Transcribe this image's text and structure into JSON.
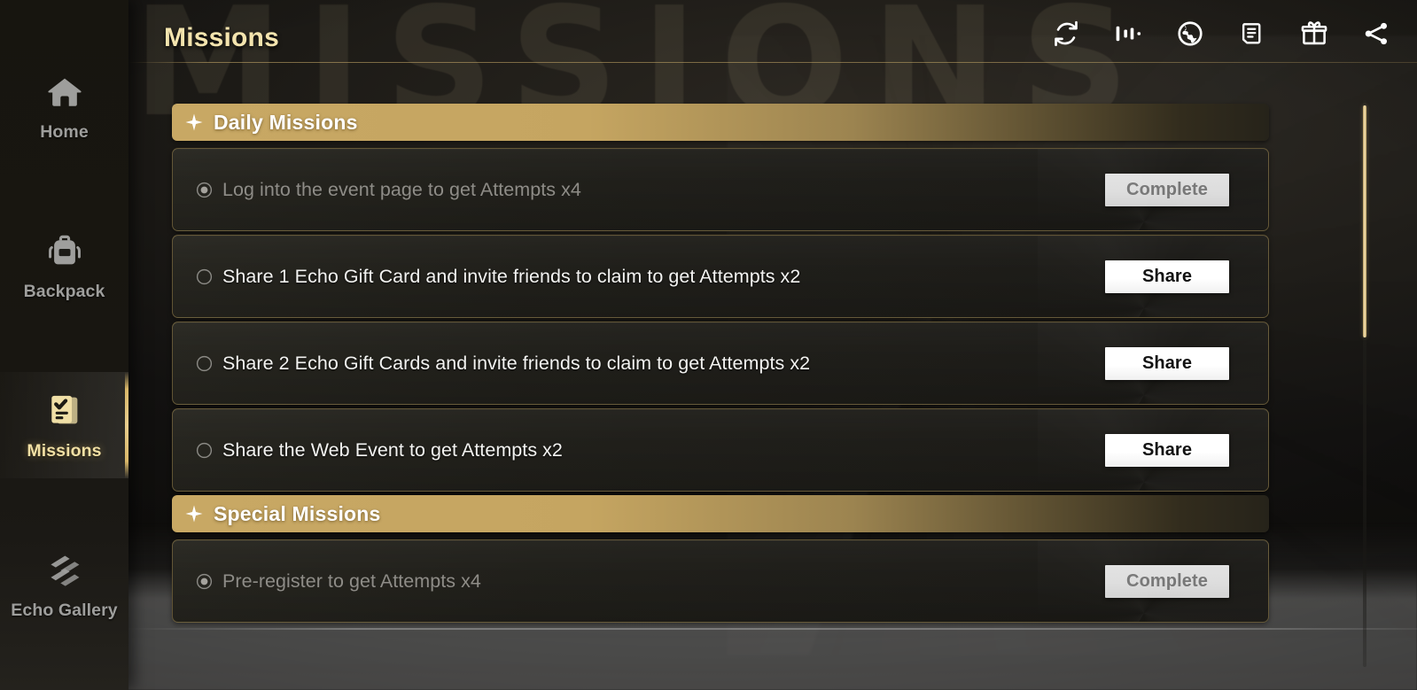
{
  "window": {
    "background_ghost_text": "MISSIONS"
  },
  "sidebar": {
    "items": [
      {
        "id": "home",
        "label": "Home",
        "icon": "home-icon",
        "active": false
      },
      {
        "id": "backpack",
        "label": "Backpack",
        "icon": "backpack-icon",
        "active": false
      },
      {
        "id": "missions",
        "label": "Missions",
        "icon": "missions-icon",
        "active": true
      },
      {
        "id": "echo-gallery",
        "label": "Echo Gallery",
        "icon": "echo-gallery-icon",
        "active": false
      }
    ]
  },
  "header": {
    "title": "Missions",
    "icons": [
      {
        "id": "refresh",
        "name": "refresh-icon",
        "title": "Refresh"
      },
      {
        "id": "ranking",
        "name": "ranking-icon",
        "title": "Ranking"
      },
      {
        "id": "language",
        "name": "globe-icon",
        "title": "Language"
      },
      {
        "id": "rules",
        "name": "rules-icon",
        "title": "Rules"
      },
      {
        "id": "rewards",
        "name": "gift-icon",
        "title": "Rewards"
      },
      {
        "id": "share",
        "name": "share-icon",
        "title": "Share"
      }
    ]
  },
  "colors": {
    "accent_gold": "#d9b769",
    "title_gold": "#f4e4ae",
    "section_gold": "#c8a864",
    "button_share_bg": "#ffffff",
    "button_complete_bg": "#dddddd",
    "button_complete_text": "#777777",
    "row_bg": "#201f1a",
    "row_border": "#b09658"
  },
  "sections": [
    {
      "id": "daily-missions",
      "title": "Daily Missions",
      "missions": [
        {
          "id": "daily-login",
          "text": "Log into the event page to get Attempts x4",
          "state": "done",
          "bullet": "radio-filled-icon",
          "action_label": "Complete",
          "action_type": "complete"
        },
        {
          "id": "daily-share-1-gift-card",
          "text": "Share 1 Echo Gift Card and invite friends to claim to get Attempts x2",
          "state": "todo",
          "bullet": "radio-empty-icon",
          "action_label": "Share",
          "action_type": "share"
        },
        {
          "id": "daily-share-2-gift-cards",
          "text": "Share 2 Echo Gift Cards and invite friends to claim to get Attempts x2",
          "state": "todo",
          "bullet": "radio-empty-icon",
          "action_label": "Share",
          "action_type": "share"
        },
        {
          "id": "daily-share-web-event",
          "text": "Share the Web Event to get Attempts x2",
          "state": "todo",
          "bullet": "radio-empty-icon",
          "action_label": "Share",
          "action_type": "share"
        }
      ]
    },
    {
      "id": "special-missions",
      "title": "Special Missions",
      "missions": [
        {
          "id": "special-pre-register",
          "text": "Pre-register to get Attempts x4",
          "state": "done",
          "bullet": "radio-filled-icon",
          "action_label": "Complete",
          "action_type": "complete"
        }
      ]
    }
  ],
  "scrollbar": {
    "orientation": "vertical",
    "thumb_top_pct": 1,
    "thumb_height_pct": 41
  }
}
